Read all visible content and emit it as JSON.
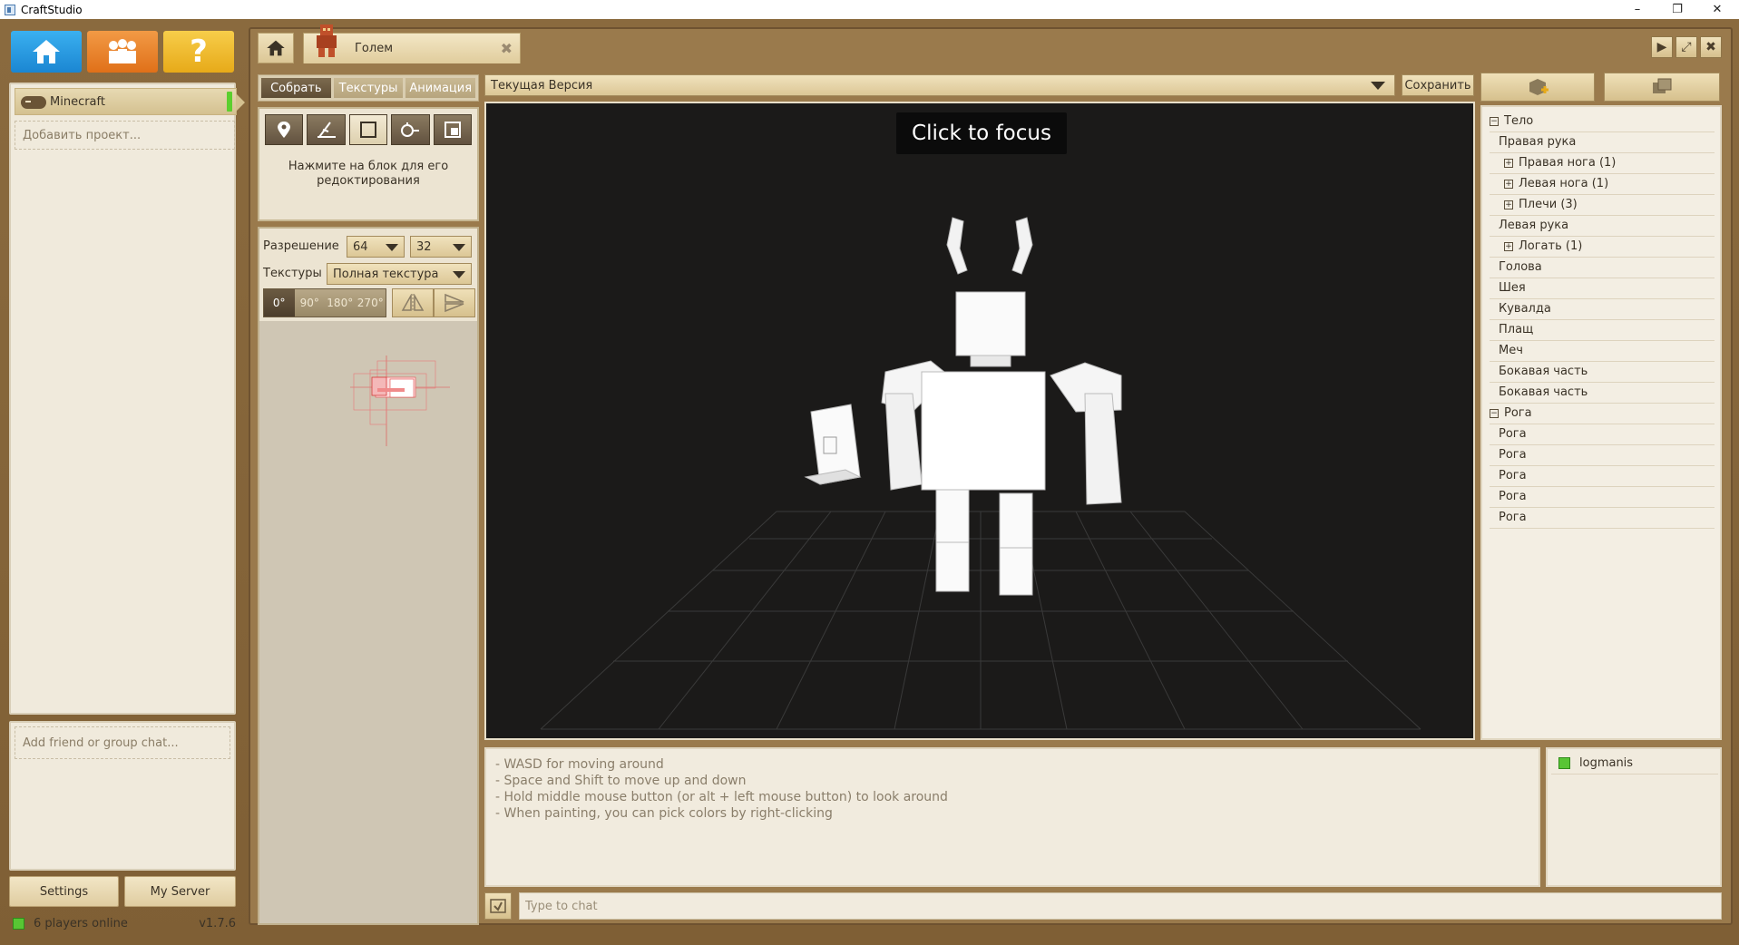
{
  "window": {
    "title": "CraftStudio",
    "minimize": "–",
    "restore": "❐",
    "close": "✕"
  },
  "nav": {
    "home": "⌂",
    "community": "👥",
    "help": "?"
  },
  "projects": {
    "items": [
      {
        "label": "Minecraft"
      }
    ],
    "add_label": "Добавить проект..."
  },
  "chat_sidebar": {
    "add_friend_label": "Add friend or group chat..."
  },
  "footer": {
    "settings_label": "Settings",
    "server_label": "My Server",
    "players_online": "6 players online",
    "version": "v1.7.6"
  },
  "tabs": {
    "document": "Голем",
    "close": "✖"
  },
  "window_controls": {
    "play": "▶",
    "maximize": "⤢",
    "close": "✖"
  },
  "mode_tabs": [
    {
      "label": "Собрать",
      "active": true
    },
    {
      "label": "Текстуры",
      "active": false
    },
    {
      "label": "Анимация",
      "active": false
    }
  ],
  "tools": {
    "hint": "Нажмите на блок для его редоктирования"
  },
  "texture": {
    "resolution_label": "Разрешение",
    "resolution_w": "64",
    "resolution_h": "32",
    "textures_label": "Текстуры",
    "texture_mode": "Полная текстура",
    "rotations": [
      "0°",
      "90°",
      "180°",
      "270°"
    ]
  },
  "version_bar": {
    "selected": "Текущая Версия",
    "save_label": "Сохранить"
  },
  "viewport": {
    "focus_label": "Click to focus"
  },
  "tree": [
    {
      "label": "Тело",
      "level": 0,
      "toggle": "⊟"
    },
    {
      "label": "Правая рука",
      "level": 1,
      "toggle": ""
    },
    {
      "label": "Правая нога (1)",
      "level": 1,
      "toggle": "⊞"
    },
    {
      "label": "Левая нога (1)",
      "level": 1,
      "toggle": "⊞"
    },
    {
      "label": "Плечи (3)",
      "level": 1,
      "toggle": "⊞"
    },
    {
      "label": "Левая рука",
      "level": 1,
      "toggle": ""
    },
    {
      "label": "Логать (1)",
      "level": 1,
      "toggle": "⊞"
    },
    {
      "label": "Голова",
      "level": 1,
      "toggle": ""
    },
    {
      "label": "Шея",
      "level": 1,
      "toggle": ""
    },
    {
      "label": "Кувалда",
      "level": 1,
      "toggle": ""
    },
    {
      "label": "Плащ",
      "level": 1,
      "toggle": ""
    },
    {
      "label": "Меч",
      "level": 1,
      "toggle": ""
    },
    {
      "label": "Бокавая часть",
      "level": 1,
      "toggle": ""
    },
    {
      "label": "Бокавая часть",
      "level": 1,
      "toggle": ""
    },
    {
      "label": "Рога",
      "level": 0,
      "toggle": "⊟"
    },
    {
      "label": "Рога",
      "level": 1,
      "toggle": ""
    },
    {
      "label": "Рога",
      "level": 1,
      "toggle": ""
    },
    {
      "label": "Рога",
      "level": 1,
      "toggle": ""
    },
    {
      "label": "Рога",
      "level": 1,
      "toggle": ""
    },
    {
      "label": "Рога",
      "level": 1,
      "toggle": ""
    }
  ],
  "help": {
    "lines": [
      "- WASD for moving around",
      "- Space and Shift to move up and down",
      "- Hold middle mouse button (or alt + left mouse button) to look around",
      "- When painting, you can pick colors by right-clicking"
    ]
  },
  "users": [
    {
      "name": "logmanis"
    }
  ],
  "chat": {
    "placeholder": "Type to chat"
  }
}
